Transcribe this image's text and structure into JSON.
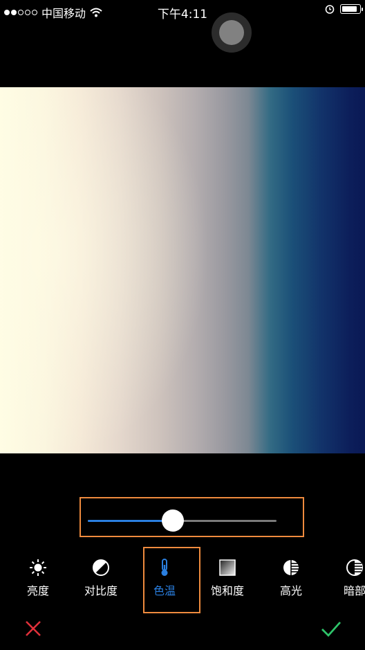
{
  "status_bar": {
    "carrier": "中国移动",
    "time": "下午4:11",
    "signal_filled": 2,
    "signal_total": 5,
    "battery_level": 0.9,
    "icons": [
      "signal-dots-icon",
      "wifi-icon",
      "alarm-icon",
      "battery-icon"
    ]
  },
  "photo": {
    "description_colors": [
      "#fffde4",
      "#b2acae",
      "#336b84",
      "#0a1955"
    ]
  },
  "slider": {
    "value": 0.45
  },
  "tools": [
    {
      "label": "亮度",
      "icon": "sun-icon",
      "active": false
    },
    {
      "label": "对比度",
      "icon": "contrast-icon",
      "active": false
    },
    {
      "label": "色温",
      "icon": "thermometer-icon",
      "active": true
    },
    {
      "label": "饱和度",
      "icon": "saturation-icon",
      "active": false
    },
    {
      "label": "高光",
      "icon": "highlights-icon",
      "active": false
    },
    {
      "label": "暗部",
      "icon": "shadows-icon",
      "active": false
    }
  ],
  "actions": {
    "cancel_icon": "close-icon",
    "confirm_icon": "checkmark-icon"
  },
  "colors": {
    "accent": "#2a7fe0",
    "highlight_box": "#ef8b3e",
    "cancel": "#e0303a",
    "confirm": "#2ec46a"
  }
}
